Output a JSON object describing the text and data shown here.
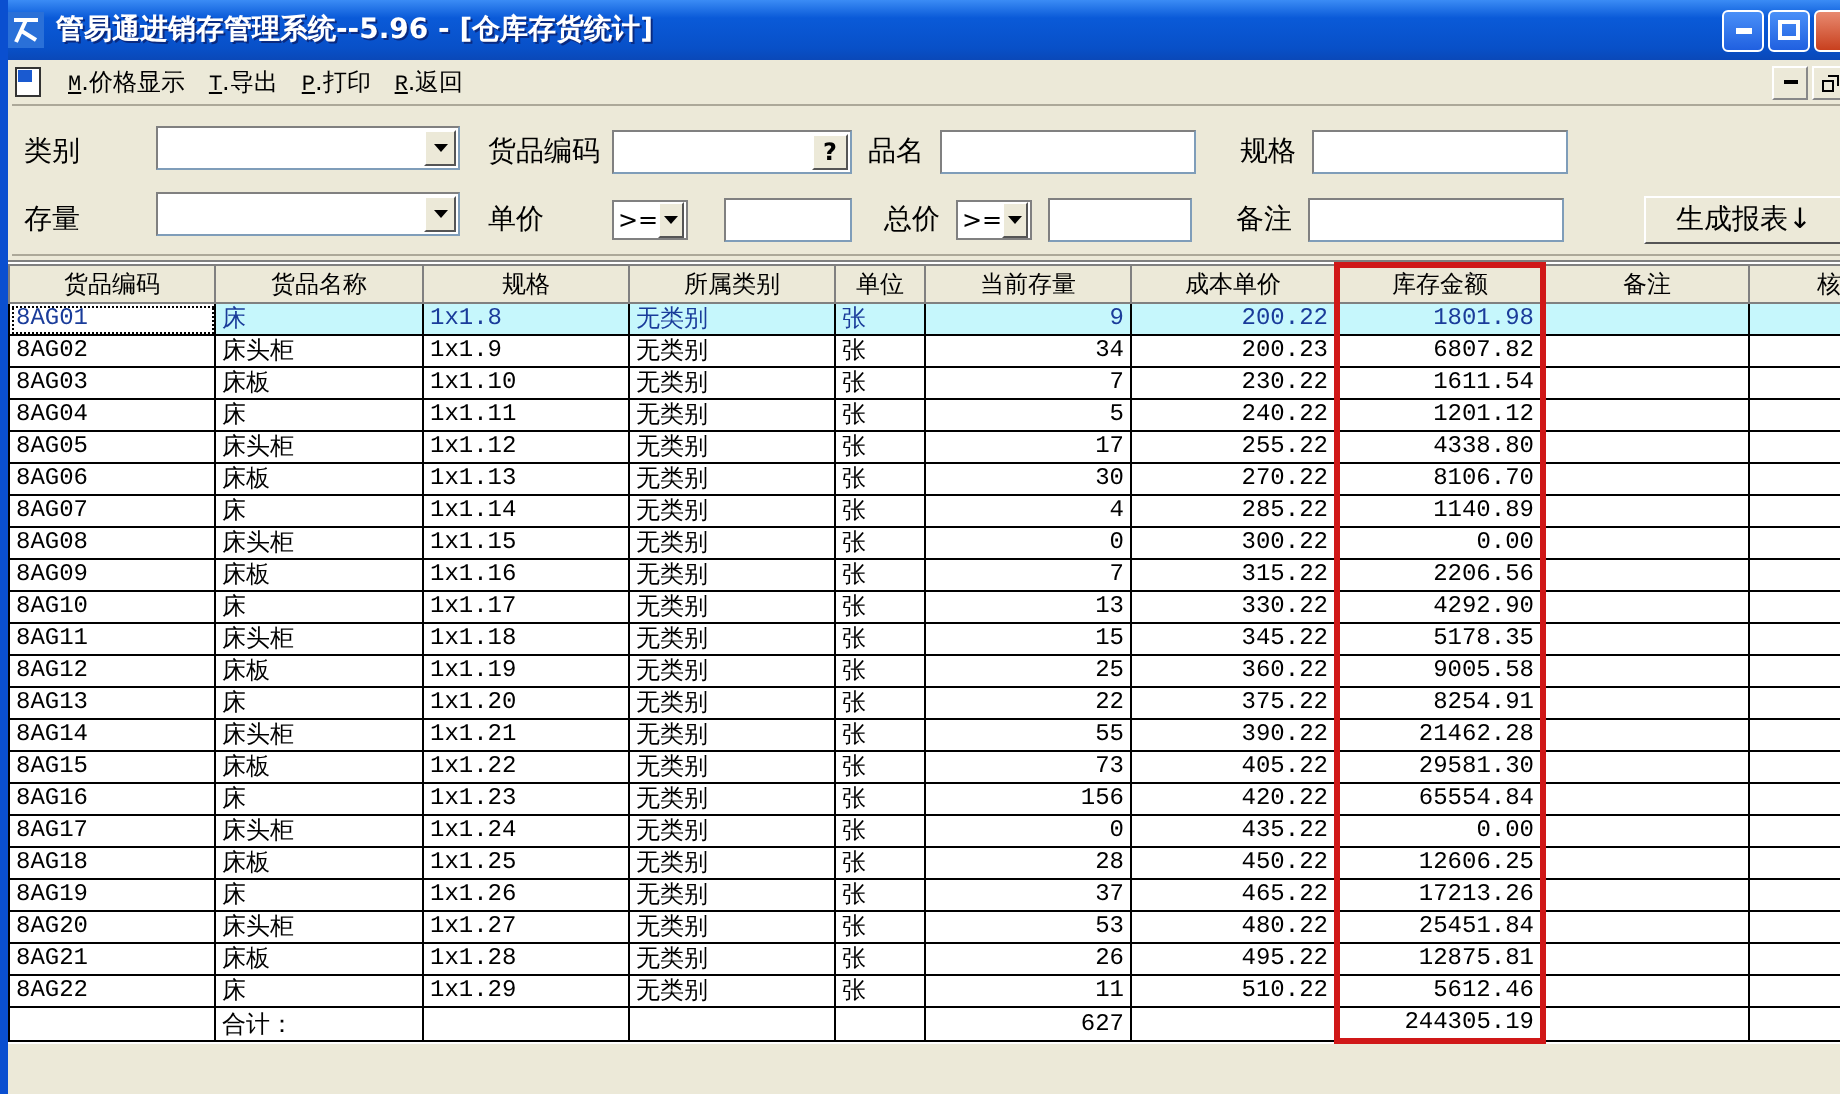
{
  "window": {
    "title": "管易通进销存管理系统--5.96 - [仓库存货统计]"
  },
  "menu": [
    "M.价格显示",
    "T.导出",
    "P.打印",
    "R.返回"
  ],
  "filters": {
    "category": {
      "label": "类别"
    },
    "product_code": {
      "label": "货品编码",
      "button": "?"
    },
    "product_name": {
      "label": "品名"
    },
    "spec": {
      "label": "规格"
    },
    "stock": {
      "label": "存量"
    },
    "unit_price": {
      "label": "单价",
      "operator": ">="
    },
    "total_price": {
      "label": "总价",
      "operator": ">="
    },
    "remark": {
      "label": "备注"
    },
    "generate_button": "生成报表↓"
  },
  "table": {
    "columns": [
      {
        "label": "货品编码",
        "kind": "text",
        "highlighted": false
      },
      {
        "label": "货品名称",
        "kind": "text",
        "highlighted": false
      },
      {
        "label": "规格",
        "kind": "text",
        "highlighted": false
      },
      {
        "label": "所属类别",
        "kind": "text",
        "highlighted": false
      },
      {
        "label": "单位",
        "kind": "text",
        "highlighted": false
      },
      {
        "label": "当前存量",
        "kind": "number",
        "highlighted": false
      },
      {
        "label": "成本单价",
        "kind": "number",
        "highlighted": false
      },
      {
        "label": "库存金额",
        "kind": "number",
        "highlighted": true
      },
      {
        "label": "备注",
        "kind": "text",
        "highlighted": false
      },
      {
        "label": "核",
        "kind": "text",
        "highlighted": false
      }
    ],
    "rows": [
      {
        "selected": true,
        "cells": [
          "8AG01",
          "床",
          "1x1.8",
          "无类别",
          "张",
          "9",
          "200.22",
          "1801.98"
        ]
      },
      {
        "selected": false,
        "cells": [
          "8AG02",
          "床头柜",
          "1x1.9",
          "无类别",
          "张",
          "34",
          "200.23",
          "6807.82"
        ]
      },
      {
        "selected": false,
        "cells": [
          "8AG03",
          "床板",
          "1x1.10",
          "无类别",
          "张",
          "7",
          "230.22",
          "1611.54"
        ]
      },
      {
        "selected": false,
        "cells": [
          "8AG04",
          "床",
          "1x1.11",
          "无类别",
          "张",
          "5",
          "240.22",
          "1201.12"
        ]
      },
      {
        "selected": false,
        "cells": [
          "8AG05",
          "床头柜",
          "1x1.12",
          "无类别",
          "张",
          "17",
          "255.22",
          "4338.80"
        ]
      },
      {
        "selected": false,
        "cells": [
          "8AG06",
          "床板",
          "1x1.13",
          "无类别",
          "张",
          "30",
          "270.22",
          "8106.70"
        ]
      },
      {
        "selected": false,
        "cells": [
          "8AG07",
          "床",
          "1x1.14",
          "无类别",
          "张",
          "4",
          "285.22",
          "1140.89"
        ]
      },
      {
        "selected": false,
        "cells": [
          "8AG08",
          "床头柜",
          "1x1.15",
          "无类别",
          "张",
          "0",
          "300.22",
          "0.00"
        ]
      },
      {
        "selected": false,
        "cells": [
          "8AG09",
          "床板",
          "1x1.16",
          "无类别",
          "张",
          "7",
          "315.22",
          "2206.56"
        ]
      },
      {
        "selected": false,
        "cells": [
          "8AG10",
          "床",
          "1x1.17",
          "无类别",
          "张",
          "13",
          "330.22",
          "4292.90"
        ]
      },
      {
        "selected": false,
        "cells": [
          "8AG11",
          "床头柜",
          "1x1.18",
          "无类别",
          "张",
          "15",
          "345.22",
          "5178.35"
        ]
      },
      {
        "selected": false,
        "cells": [
          "8AG12",
          "床板",
          "1x1.19",
          "无类别",
          "张",
          "25",
          "360.22",
          "9005.58"
        ]
      },
      {
        "selected": false,
        "cells": [
          "8AG13",
          "床",
          "1x1.20",
          "无类别",
          "张",
          "22",
          "375.22",
          "8254.91"
        ]
      },
      {
        "selected": false,
        "cells": [
          "8AG14",
          "床头柜",
          "1x1.21",
          "无类别",
          "张",
          "55",
          "390.22",
          "21462.28"
        ]
      },
      {
        "selected": false,
        "cells": [
          "8AG15",
          "床板",
          "1x1.22",
          "无类别",
          "张",
          "73",
          "405.22",
          "29581.30"
        ]
      },
      {
        "selected": false,
        "cells": [
          "8AG16",
          "床",
          "1x1.23",
          "无类别",
          "张",
          "156",
          "420.22",
          "65554.84"
        ]
      },
      {
        "selected": false,
        "cells": [
          "8AG17",
          "床头柜",
          "1x1.24",
          "无类别",
          "张",
          "0",
          "435.22",
          "0.00"
        ]
      },
      {
        "selected": false,
        "cells": [
          "8AG18",
          "床板",
          "1x1.25",
          "无类别",
          "张",
          "28",
          "450.22",
          "12606.25"
        ]
      },
      {
        "selected": false,
        "cells": [
          "8AG19",
          "床",
          "1x1.26",
          "无类别",
          "张",
          "37",
          "465.22",
          "17213.26"
        ]
      },
      {
        "selected": false,
        "cells": [
          "8AG20",
          "床头柜",
          "1x1.27",
          "无类别",
          "张",
          "53",
          "480.22",
          "25451.84"
        ]
      },
      {
        "selected": false,
        "cells": [
          "8AG21",
          "床板",
          "1x1.28",
          "无类别",
          "张",
          "26",
          "495.22",
          "12875.81"
        ]
      },
      {
        "selected": false,
        "cells": [
          "8AG22",
          "床",
          "1x1.29",
          "无类别",
          "张",
          "11",
          "510.22",
          "5612.46"
        ]
      }
    ],
    "total": {
      "label": "合计：",
      "quantity": "627",
      "amount": "244305.19"
    }
  }
}
